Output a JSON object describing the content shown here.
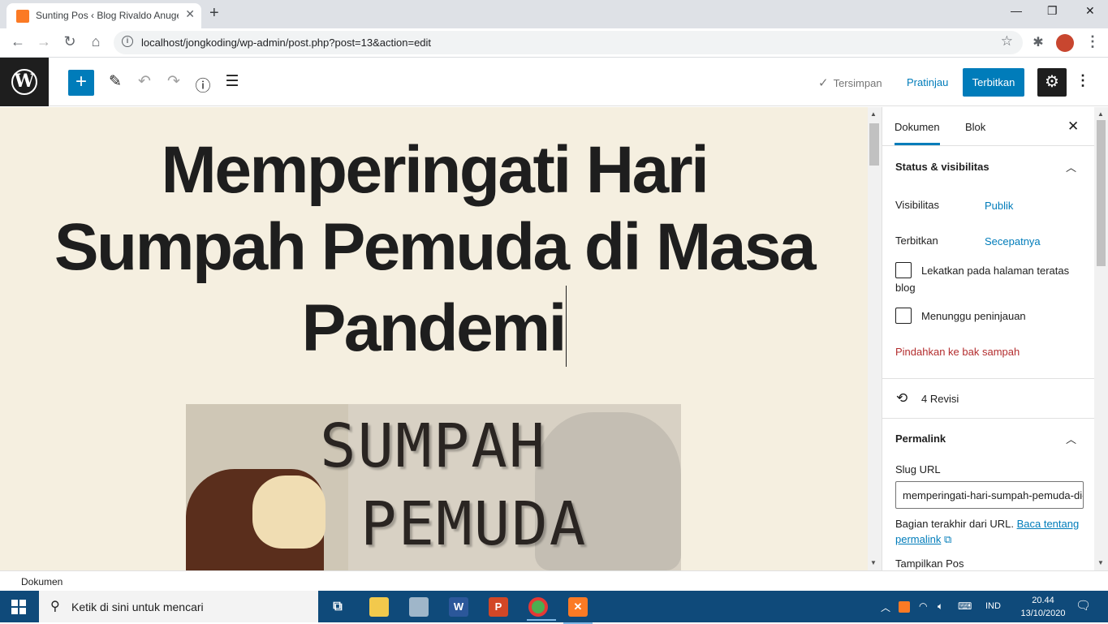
{
  "browser": {
    "tab_title": "Sunting Pos ‹ Blog Rivaldo Anugerah",
    "url": "localhost/jongkoding/wp-admin/post.php?post=13&action=edit"
  },
  "editor_header": {
    "saved_label": "Tersimpan",
    "preview_label": "Pratinjau",
    "publish_label": "Terbitkan"
  },
  "post": {
    "title_line1": "Memperingati Hari",
    "title_line2": "Sumpah Pemuda di Masa",
    "title_line3": "Pandemi",
    "image_text_line1": "SUMPAH",
    "image_text_line2": "PEMUDA"
  },
  "sidebar": {
    "tab_document": "Dokumen",
    "tab_block": "Blok",
    "status_panel": {
      "title": "Status & visibilitas",
      "visibility_label": "Visibilitas",
      "visibility_value": "Publik",
      "publish_label": "Terbitkan",
      "publish_value": "Secepatnya",
      "sticky_label": "Lekatkan pada halaman teratas blog",
      "pending_label": "Menunggu peninjauan",
      "trash_label": "Pindahkan ke bak sampah"
    },
    "revisions_label": "4 Revisi",
    "permalink_panel": {
      "title": "Permalink",
      "slug_label": "Slug URL",
      "slug_value": "memperingati-hari-sumpah-pemuda-di-masa-pandemi",
      "help_text": "Bagian terakhir dari URL.",
      "help_link": "Baca tentang permalink"
    },
    "show_post_label": "Tampilkan Pos"
  },
  "status_bar": {
    "label": "Dokumen"
  },
  "taskbar": {
    "search_placeholder": "Ketik di sini untuk mencari",
    "language": "IND",
    "time": "20.44",
    "date": "13/10/2020"
  }
}
